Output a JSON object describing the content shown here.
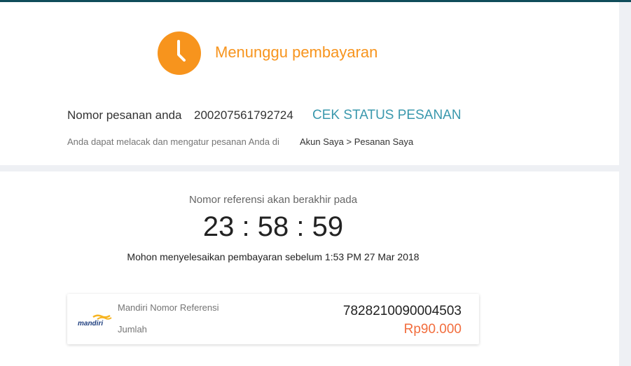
{
  "status": {
    "icon": "clock-icon",
    "title": "Menunggu pembayaran",
    "color": "#f7941d"
  },
  "order": {
    "label": "Nomor pesanan anda",
    "number": "200207561792724",
    "check_status_label": "CEK STATUS PESANAN",
    "track_text": "Anda dapat melacak dan mengatur pesanan Anda di",
    "track_link": "Akun Saya > Pesanan Saya"
  },
  "payment": {
    "expire_label": "Nomor referensi akan berakhir pada",
    "timer": "23 : 58 : 59",
    "deadline_text": "Mohon menyelesaikan pembayaran sebelum 1:53 PM 27 Mar 2018",
    "bank_logo_text": "mandiri",
    "reference_label": "Mandiri Nomor Referensi",
    "reference_number": "7828210090004503",
    "amount_label": "Jumlah",
    "amount": "Rp90.000",
    "amount_color": "#f26d3d"
  },
  "colors": {
    "accent": "#f7941d",
    "link": "#3a98ad",
    "topbar": "#0f4c5a"
  }
}
